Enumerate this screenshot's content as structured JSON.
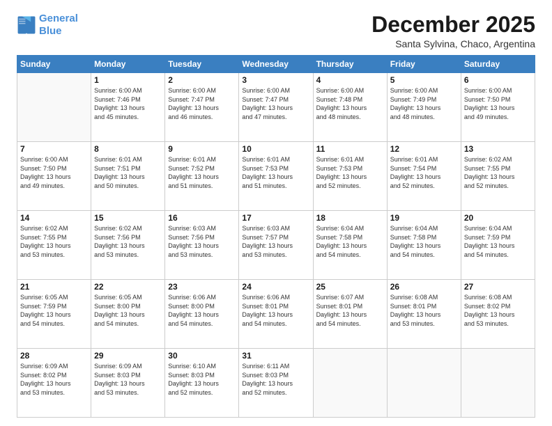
{
  "logo": {
    "line1": "General",
    "line2": "Blue"
  },
  "title": "December 2025",
  "location": "Santa Sylvina, Chaco, Argentina",
  "weekdays": [
    "Sunday",
    "Monday",
    "Tuesday",
    "Wednesday",
    "Thursday",
    "Friday",
    "Saturday"
  ],
  "weeks": [
    [
      {
        "day": "",
        "info": ""
      },
      {
        "day": "1",
        "info": "Sunrise: 6:00 AM\nSunset: 7:46 PM\nDaylight: 13 hours\nand 45 minutes."
      },
      {
        "day": "2",
        "info": "Sunrise: 6:00 AM\nSunset: 7:47 PM\nDaylight: 13 hours\nand 46 minutes."
      },
      {
        "day": "3",
        "info": "Sunrise: 6:00 AM\nSunset: 7:47 PM\nDaylight: 13 hours\nand 47 minutes."
      },
      {
        "day": "4",
        "info": "Sunrise: 6:00 AM\nSunset: 7:48 PM\nDaylight: 13 hours\nand 48 minutes."
      },
      {
        "day": "5",
        "info": "Sunrise: 6:00 AM\nSunset: 7:49 PM\nDaylight: 13 hours\nand 48 minutes."
      },
      {
        "day": "6",
        "info": "Sunrise: 6:00 AM\nSunset: 7:50 PM\nDaylight: 13 hours\nand 49 minutes."
      }
    ],
    [
      {
        "day": "7",
        "info": "Sunrise: 6:00 AM\nSunset: 7:50 PM\nDaylight: 13 hours\nand 49 minutes."
      },
      {
        "day": "8",
        "info": "Sunrise: 6:01 AM\nSunset: 7:51 PM\nDaylight: 13 hours\nand 50 minutes."
      },
      {
        "day": "9",
        "info": "Sunrise: 6:01 AM\nSunset: 7:52 PM\nDaylight: 13 hours\nand 51 minutes."
      },
      {
        "day": "10",
        "info": "Sunrise: 6:01 AM\nSunset: 7:53 PM\nDaylight: 13 hours\nand 51 minutes."
      },
      {
        "day": "11",
        "info": "Sunrise: 6:01 AM\nSunset: 7:53 PM\nDaylight: 13 hours\nand 52 minutes."
      },
      {
        "day": "12",
        "info": "Sunrise: 6:01 AM\nSunset: 7:54 PM\nDaylight: 13 hours\nand 52 minutes."
      },
      {
        "day": "13",
        "info": "Sunrise: 6:02 AM\nSunset: 7:55 PM\nDaylight: 13 hours\nand 52 minutes."
      }
    ],
    [
      {
        "day": "14",
        "info": "Sunrise: 6:02 AM\nSunset: 7:55 PM\nDaylight: 13 hours\nand 53 minutes."
      },
      {
        "day": "15",
        "info": "Sunrise: 6:02 AM\nSunset: 7:56 PM\nDaylight: 13 hours\nand 53 minutes."
      },
      {
        "day": "16",
        "info": "Sunrise: 6:03 AM\nSunset: 7:56 PM\nDaylight: 13 hours\nand 53 minutes."
      },
      {
        "day": "17",
        "info": "Sunrise: 6:03 AM\nSunset: 7:57 PM\nDaylight: 13 hours\nand 53 minutes."
      },
      {
        "day": "18",
        "info": "Sunrise: 6:04 AM\nSunset: 7:58 PM\nDaylight: 13 hours\nand 54 minutes."
      },
      {
        "day": "19",
        "info": "Sunrise: 6:04 AM\nSunset: 7:58 PM\nDaylight: 13 hours\nand 54 minutes."
      },
      {
        "day": "20",
        "info": "Sunrise: 6:04 AM\nSunset: 7:59 PM\nDaylight: 13 hours\nand 54 minutes."
      }
    ],
    [
      {
        "day": "21",
        "info": "Sunrise: 6:05 AM\nSunset: 7:59 PM\nDaylight: 13 hours\nand 54 minutes."
      },
      {
        "day": "22",
        "info": "Sunrise: 6:05 AM\nSunset: 8:00 PM\nDaylight: 13 hours\nand 54 minutes."
      },
      {
        "day": "23",
        "info": "Sunrise: 6:06 AM\nSunset: 8:00 PM\nDaylight: 13 hours\nand 54 minutes."
      },
      {
        "day": "24",
        "info": "Sunrise: 6:06 AM\nSunset: 8:01 PM\nDaylight: 13 hours\nand 54 minutes."
      },
      {
        "day": "25",
        "info": "Sunrise: 6:07 AM\nSunset: 8:01 PM\nDaylight: 13 hours\nand 54 minutes."
      },
      {
        "day": "26",
        "info": "Sunrise: 6:08 AM\nSunset: 8:01 PM\nDaylight: 13 hours\nand 53 minutes."
      },
      {
        "day": "27",
        "info": "Sunrise: 6:08 AM\nSunset: 8:02 PM\nDaylight: 13 hours\nand 53 minutes."
      }
    ],
    [
      {
        "day": "28",
        "info": "Sunrise: 6:09 AM\nSunset: 8:02 PM\nDaylight: 13 hours\nand 53 minutes."
      },
      {
        "day": "29",
        "info": "Sunrise: 6:09 AM\nSunset: 8:03 PM\nDaylight: 13 hours\nand 53 minutes."
      },
      {
        "day": "30",
        "info": "Sunrise: 6:10 AM\nSunset: 8:03 PM\nDaylight: 13 hours\nand 52 minutes."
      },
      {
        "day": "31",
        "info": "Sunrise: 6:11 AM\nSunset: 8:03 PM\nDaylight: 13 hours\nand 52 minutes."
      },
      {
        "day": "",
        "info": ""
      },
      {
        "day": "",
        "info": ""
      },
      {
        "day": "",
        "info": ""
      }
    ]
  ]
}
